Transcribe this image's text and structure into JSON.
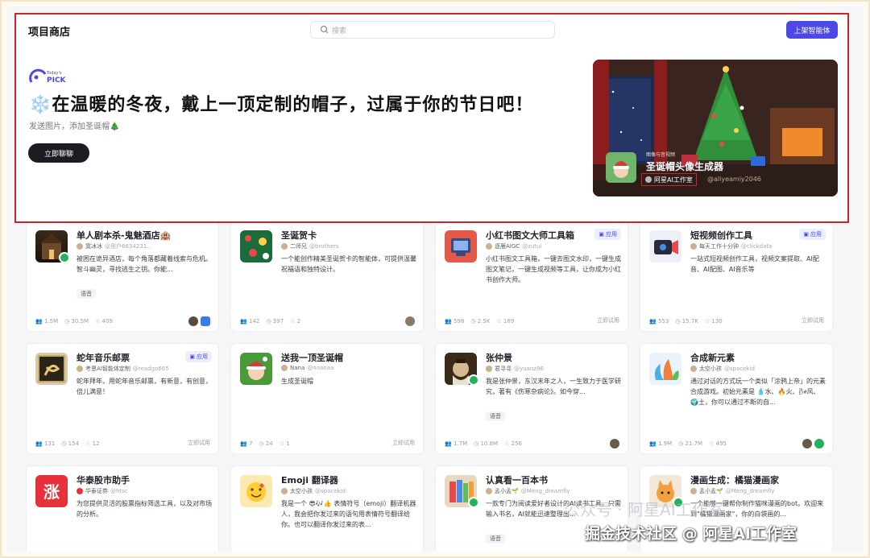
{
  "header": {
    "title": "项目商店",
    "search_placeholder": "搜索",
    "publish_button": "上架智能体"
  },
  "hero": {
    "logo_text": "Today's PICK",
    "title_emoji": "❄️",
    "title": "在温暖的冬夜，戴上一顶定制的帽子，过属于你的节日吧！",
    "subtitle": "发送图片，添加圣诞帽🎄",
    "button": "立即聊聊",
    "banner": {
      "category": "图像与音视频",
      "title": "圣诞帽头像生成器",
      "author": "阿星AI工作室",
      "handle": "@aliyeamiy2046"
    }
  },
  "cards": [
    {
      "name": "单人剧本杀-鬼魅酒店🏨",
      "author": "寞冰冰",
      "handle": "@用户6634231..",
      "desc": "被困在诡异酒店，每个角落都藏着线索与危机。智斗幽灵，寻找逃生之钥。你能...",
      "voice": "语音",
      "stats": [
        "1.5M",
        "30.5M",
        "409"
      ],
      "call": true
    },
    {
      "name": "圣诞贺卡",
      "author": "二师兄",
      "handle": "@brothers",
      "desc": "一个能创作精美圣诞贺卡的智能体，可提供温馨祝福语和独特设计。",
      "stats": [
        "142",
        "397",
        "2"
      ]
    },
    {
      "name": "小红书图文大师工具箱",
      "tag": "应用",
      "author": "逐雁AIGC",
      "handle": "@zutui",
      "desc": "小红书图文工具箱，一键去图文水印，一键生成图文笔记，一键生成视频等工具，让你成为小红书创作大师。",
      "stats": [
        "598",
        "2.5K",
        "169"
      ],
      "try": "立即试用"
    },
    {
      "name": "短视频创作工具",
      "tag": "应用",
      "author": "每天工作十分钟",
      "handle": "@clickdata",
      "desc": "一站式短视频创作工具，视频文案提取、AI配音、AI配图、AI音乐等",
      "stats": [
        "553",
        "15.7K",
        "130"
      ],
      "try": "立即试用"
    },
    {
      "name": "蛇年音乐邮票",
      "tag": "应用",
      "author": "考恩AI智能体定制",
      "handle": "@readgo665",
      "desc": "蛇年拜年，用蛇年音乐邮票，有新意，有创意，倍儿满意！",
      "stats": [
        "131",
        "154",
        "12"
      ],
      "try": "立即试用"
    },
    {
      "name": "送我一顶圣诞帽",
      "author": "Nana",
      "handle": "@noanaa",
      "desc": "生成圣诞帽",
      "stats": [
        "7",
        "24",
        "1"
      ],
      "try": "立即试用"
    },
    {
      "name": "张仲景",
      "author": "君寻寻",
      "handle": "@yuanz96",
      "desc": "我是张仲景，东汉末年之人，一生致力于医学研究，著有《伤寒杂病论》。如今穿...",
      "voice": "语音",
      "stats": [
        "1.7M",
        "10.8M",
        "256"
      ],
      "call": true
    },
    {
      "name": "合成新元素",
      "author": "太空小孩",
      "handle": "@spacekid",
      "desc": "通过对话的方式玩一个类似「涂鸦上帝」的元素合成游戏。初始元素是 💧水、🔥火、🌬风、🌍土，你可以通过不断的自...",
      "stats": [
        "1.9M",
        "21.7M",
        "495"
      ]
    },
    {
      "name": "华泰股市助手",
      "author": "华泰证券",
      "handle": "@htsc",
      "desc": "为您提供灵活的股票指标筛选工具，以及对市场的分析。",
      "stats": [],
      "call": false
    },
    {
      "name": "Emoji 翻译器",
      "author": "太空小孩",
      "handle": "@spacekid",
      "desc": "我是一个 😎🎶👍 表情符号（emoji）翻译机器人，我会把你发过来的语句用表情符号翻译给你。也可以翻译你发过来的表...",
      "stats": []
    },
    {
      "name": "认真看一百本书",
      "author": "孟小孟🌱",
      "handle": "@Meng_dreamfly",
      "desc": "一款专门为阅读爱好者设计的AI读书工具。只需输入书名，AI就能迅速整理出...",
      "voice": "语音",
      "stats": [],
      "call": true
    },
    {
      "name": "漫画生成：橘猫漫画家",
      "author": "孟小孟🌱",
      "handle": "@Meng_dreamfly",
      "desc": "一个能够一键帮你制作猫咪漫画的bot。欢迎来到\"橘猫漫画家\"，你的白袋画的...",
      "stats": [],
      "call": true
    }
  ],
  "watermark": "掘金技术社区 @ 阿星AI工作室",
  "watermark_faint": "公众号 · 阿星AI工作室"
}
